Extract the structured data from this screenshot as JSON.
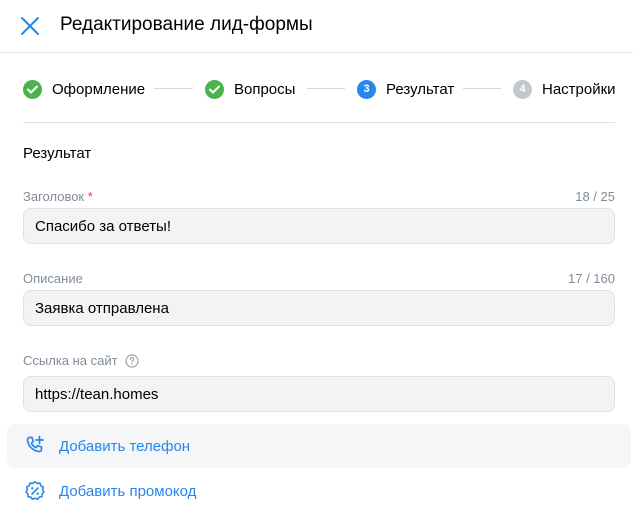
{
  "header": {
    "title": "Редактирование лид-формы",
    "close_icon": "close-icon"
  },
  "stepper": {
    "steps": [
      {
        "label": "Оформление",
        "state": "done",
        "badge": ""
      },
      {
        "label": "Вопросы",
        "state": "done",
        "badge": ""
      },
      {
        "label": "Результат",
        "state": "active",
        "badge": "3"
      },
      {
        "label": "Настройки",
        "state": "pending",
        "badge": "4"
      }
    ]
  },
  "section": {
    "title": "Результат"
  },
  "fields": {
    "heading": {
      "label": "Заголовок",
      "required_mark": "*",
      "counter": "18 / 25",
      "value": "Спасибо за ответы!"
    },
    "description": {
      "label": "Описание",
      "counter": "17 / 160",
      "value": "Заявка отправлена"
    },
    "site_link": {
      "label": "Ссылка на сайт",
      "value": "https://tean.homes",
      "help_icon": "question-circle-icon"
    }
  },
  "actions": {
    "add_phone": {
      "label": "Добавить телефон",
      "icon": "phone-add-icon"
    },
    "add_promo": {
      "label": "Добавить промокод",
      "icon": "discount-icon"
    }
  },
  "colors": {
    "accent": "#2688eb",
    "done": "#4bb34b",
    "pending": "#c4c8cc",
    "required": "#e64646"
  }
}
